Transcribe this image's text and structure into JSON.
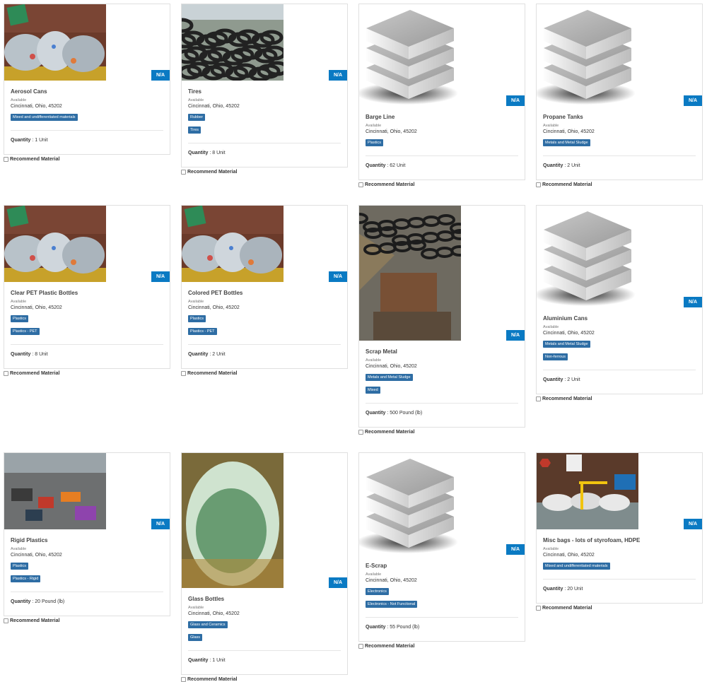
{
  "na_label": "N/A",
  "available_label": "Available",
  "quantity_label": "Quantity",
  "recommend_label": "Recommend Material",
  "colors": {
    "badge": "#0a7ac3",
    "tag": "#2e6da4"
  },
  "items": [
    {
      "title": "Aerosol Cans",
      "status": "Available",
      "location": "Cincinnati, Ohio, 45202",
      "tags": [
        "Mixed and undifferentiated materials"
      ],
      "quantity": "1 Unit",
      "image": "photo-bags"
    },
    {
      "title": "Tires",
      "status": "Available",
      "location": "Cincinnati, Ohio, 45202",
      "tags": [
        "Rubber",
        "Tires"
      ],
      "quantity": "8 Unit",
      "image": "photo-tires"
    },
    {
      "title": "Barge Line",
      "status": "Available",
      "location": "Cincinnati, Ohio, 45202",
      "tags": [
        "Plastics"
      ],
      "quantity": "62 Unit",
      "image": "placeholder-layers"
    },
    {
      "title": "Propane Tanks",
      "status": "Available",
      "location": "Cincinnati, Ohio, 45202",
      "tags": [
        "Metals and Metal Sludge"
      ],
      "quantity": "2 Unit",
      "image": "placeholder-layers"
    },
    {
      "title": "Clear PET Plastic Bottles",
      "status": "Available",
      "location": "Cincinnati, Ohio, 45202",
      "tags": [
        "Plastics",
        "Plastics - PET"
      ],
      "quantity": "8 Unit",
      "image": "photo-bags"
    },
    {
      "title": "Colored PET Bottles",
      "status": "Available",
      "location": "Cincinnati, Ohio, 45202",
      "tags": [
        "Plastics",
        "Plastics - PET"
      ],
      "quantity": "2 Unit",
      "image": "photo-bags"
    },
    {
      "title": "Scrap Metal",
      "status": "Available",
      "location": "Cincinnati, Ohio, 45202",
      "tags": [
        "Metals and Metal Sludge",
        "Mixed"
      ],
      "quantity": "500 Pound (lb)",
      "image": "photo-scrap"
    },
    {
      "title": "Aluminium Cans",
      "status": "Available",
      "location": "Cincinnati, Ohio, 45202",
      "tags": [
        "Metals and Metal Sludge",
        "Non-ferrous"
      ],
      "quantity": "2 Unit",
      "image": "placeholder-layers"
    },
    {
      "title": "Rigid Plastics",
      "status": "Available",
      "location": "Cincinnati, Ohio, 45202",
      "tags": [
        "Plastics",
        "Plastics - Rigid"
      ],
      "quantity": "20 Pound (lb)",
      "image": "photo-rigid"
    },
    {
      "title": "Glass Bottles",
      "status": "Available",
      "location": "Cincinnati, Ohio, 45202",
      "tags": [
        "Glass and Ceramics",
        "Glass"
      ],
      "quantity": "1 Unit",
      "image": "photo-glass"
    },
    {
      "title": "E-Scrap",
      "status": "Available",
      "location": "Cincinnati, Ohio, 45202",
      "tags": [
        "Electronics",
        "Electronics - Not Functional"
      ],
      "quantity": "55 Pound (lb)",
      "image": "placeholder-layers"
    },
    {
      "title": "Misc bags - lots of styrofoam, HDPE",
      "status": "Available",
      "location": "Cincinnati, Ohio, 45202",
      "tags": [
        "Mixed and undifferentiated materials"
      ],
      "quantity": "20 Unit",
      "image": "photo-misc"
    }
  ]
}
